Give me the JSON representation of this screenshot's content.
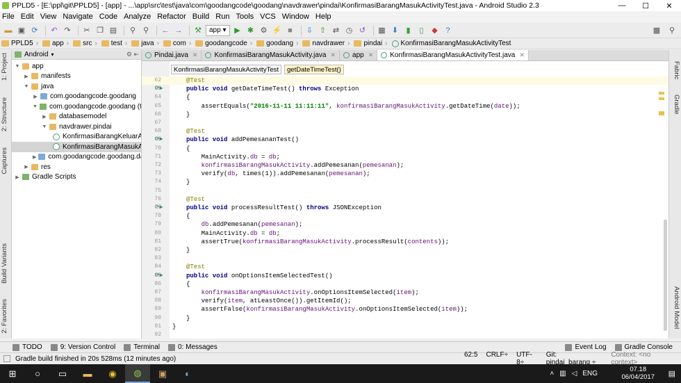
{
  "window": {
    "title": "PPLD5 - [E:\\ppl\\git\\PPLD5] - [app] - ...\\app\\src\\test\\java\\com\\goodangcode\\goodang\\navdrawer\\pindai\\KonfirmasiBarangMasukActivityTest.java - Android Studio 2.3"
  },
  "menu": [
    "File",
    "Edit",
    "View",
    "Navigate",
    "Code",
    "Analyze",
    "Refactor",
    "Build",
    "Run",
    "Tools",
    "VCS",
    "Window",
    "Help"
  ],
  "toolbar": {
    "run_config": "app"
  },
  "breadcrumb": [
    "PPLD5",
    "app",
    "src",
    "test",
    "java",
    "com",
    "goodangcode",
    "goodang",
    "navdrawer",
    "pindai",
    "KonfirmasiBarangMasukActivityTest"
  ],
  "left_tabs": [
    "1: Project",
    "2: Structure",
    "Captures",
    "Build Variants",
    "2: Favorites"
  ],
  "right_tabs": [
    "Fabric",
    "Gradle",
    "Android Model"
  ],
  "project": {
    "view": "Android",
    "tree": [
      {
        "label": "app",
        "level": 0,
        "icon": "folder",
        "open": true
      },
      {
        "label": "manifests",
        "level": 1,
        "icon": "folder",
        "open": false
      },
      {
        "label": "java",
        "level": 1,
        "icon": "folder",
        "open": true
      },
      {
        "label": "com.goodangcode.goodang",
        "level": 2,
        "icon": "package",
        "open": false
      },
      {
        "label": "com.goodangcode.goodang (test)",
        "level": 2,
        "icon": "package-test",
        "open": true
      },
      {
        "label": "databasemodel",
        "level": 3,
        "icon": "folder",
        "open": false
      },
      {
        "label": "navdrawer.pindai",
        "level": 3,
        "icon": "folder",
        "open": true
      },
      {
        "label": "KonfirmasiBarangKeluarActivityTest",
        "level": 4,
        "icon": "class"
      },
      {
        "label": "KonfirmasiBarangMasukActivityTest",
        "level": 4,
        "icon": "class",
        "selected": true
      },
      {
        "label": "com.goodangcode.goodang.database",
        "level": 2,
        "icon": "package",
        "open": false
      },
      {
        "label": "res",
        "level": 1,
        "icon": "folder",
        "open": false
      },
      {
        "label": "Gradle Scripts",
        "level": 0,
        "icon": "gradle",
        "open": false
      }
    ]
  },
  "tabs": [
    {
      "label": "Pindai.java",
      "active": false
    },
    {
      "label": "KonfirmasiBarangMasukActivity.java",
      "active": false
    },
    {
      "label": "app",
      "active": false
    },
    {
      "label": "KonfirmasiBarangMasukActivityTest.java",
      "active": true
    }
  ],
  "editor_breadcrumb": [
    "KonfirmasiBarangMasukActivityTest",
    "getDateTimeTest()"
  ],
  "code": [
    {
      "n": "62",
      "t": [
        [
          "ann",
          "@Test"
        ]
      ],
      "hl": true
    },
    {
      "n": "63",
      "gi": true,
      "t": [
        [
          "kw",
          "public void "
        ],
        [
          "",
          "getDateTimeTest() "
        ],
        [
          "kw",
          "throws "
        ],
        [
          "",
          "Exception"
        ]
      ]
    },
    {
      "n": "64",
      "t": [
        [
          "",
          "{"
        ]
      ]
    },
    {
      "n": "65",
      "t": [
        [
          "",
          "    assertEquals("
        ],
        [
          "str",
          "\"2016-11-11 11:11:11\""
        ],
        [
          "",
          ", "
        ],
        [
          "fld",
          "konfirmasiBarangMasukActivity"
        ],
        [
          "",
          ".getDateTime("
        ],
        [
          "fld",
          "date"
        ],
        [
          "",
          "));"
        ]
      ]
    },
    {
      "n": "66",
      "t": [
        [
          "",
          "}"
        ]
      ]
    },
    {
      "n": "67",
      "t": []
    },
    {
      "n": "68",
      "t": [
        [
          "ann",
          "@Test"
        ]
      ]
    },
    {
      "n": "69",
      "gi": true,
      "t": [
        [
          "kw",
          "public void "
        ],
        [
          "",
          "addPemesananTest()"
        ]
      ]
    },
    {
      "n": "70",
      "t": [
        [
          "",
          "{"
        ]
      ]
    },
    {
      "n": "71",
      "t": [
        [
          "",
          "    MainActivity."
        ],
        [
          "fld",
          "db"
        ],
        [
          "",
          " = "
        ],
        [
          "fld",
          "db"
        ],
        [
          "",
          ";"
        ]
      ]
    },
    {
      "n": "72",
      "t": [
        [
          "",
          "    "
        ],
        [
          "fld",
          "konfirmasiBarangMasukActivity"
        ],
        [
          "",
          ".addPemesanan("
        ],
        [
          "fld",
          "pemesanan"
        ],
        [
          "",
          ");"
        ]
      ]
    },
    {
      "n": "73",
      "t": [
        [
          "",
          "    verify("
        ],
        [
          "fld",
          "db"
        ],
        [
          "",
          ", times(1)).addPemesanan("
        ],
        [
          "fld",
          "pemesanan"
        ],
        [
          "",
          ");"
        ]
      ]
    },
    {
      "n": "74",
      "t": [
        [
          "",
          "}"
        ]
      ]
    },
    {
      "n": "75",
      "t": []
    },
    {
      "n": "76",
      "t": [
        [
          "ann",
          "@Test"
        ]
      ]
    },
    {
      "n": "77",
      "gi": true,
      "t": [
        [
          "kw",
          "public void "
        ],
        [
          "",
          "processResultTest() "
        ],
        [
          "kw",
          "throws "
        ],
        [
          "",
          "JSONException"
        ]
      ]
    },
    {
      "n": "78",
      "t": [
        [
          "",
          "{"
        ]
      ]
    },
    {
      "n": "79",
      "t": [
        [
          "",
          "    "
        ],
        [
          "fld",
          "db"
        ],
        [
          "",
          ".addPemesanan("
        ],
        [
          "fld",
          "pemesanan"
        ],
        [
          "",
          ");"
        ]
      ]
    },
    {
      "n": "80",
      "t": [
        [
          "",
          "    MainActivity."
        ],
        [
          "fld",
          "db"
        ],
        [
          "",
          " = "
        ],
        [
          "fld",
          "db"
        ],
        [
          "",
          ";"
        ]
      ]
    },
    {
      "n": "81",
      "t": [
        [
          "",
          "    assertTrue("
        ],
        [
          "fld",
          "konfirmasiBarangMasukActivity"
        ],
        [
          "",
          ".processResult("
        ],
        [
          "fld",
          "contents"
        ],
        [
          "",
          "));"
        ]
      ]
    },
    {
      "n": "82",
      "t": [
        [
          "",
          "}"
        ]
      ]
    },
    {
      "n": "83",
      "t": []
    },
    {
      "n": "84",
      "t": [
        [
          "ann",
          "@Test"
        ]
      ]
    },
    {
      "n": "85",
      "gi": true,
      "t": [
        [
          "kw",
          "public void "
        ],
        [
          "",
          "onOptionsItemSelectedTest()"
        ]
      ]
    },
    {
      "n": "86",
      "t": [
        [
          "",
          "{"
        ]
      ]
    },
    {
      "n": "87",
      "t": [
        [
          "",
          "    "
        ],
        [
          "fld",
          "konfirmasiBarangMasukActivity"
        ],
        [
          "",
          ".onOptionsItemSelected("
        ],
        [
          "fld",
          "item"
        ],
        [
          "",
          ");"
        ]
      ]
    },
    {
      "n": "88",
      "t": [
        [
          "",
          "    verify("
        ],
        [
          "fld",
          "item"
        ],
        [
          "",
          ", atLeastOnce()).getItemId();"
        ]
      ]
    },
    {
      "n": "89",
      "t": [
        [
          "",
          "    assertFalse("
        ],
        [
          "fld",
          "konfirmasiBarangMasukActivity"
        ],
        [
          "",
          ".onOptionsItemSelected("
        ],
        [
          "fld",
          "item"
        ],
        [
          "",
          "));"
        ]
      ]
    },
    {
      "n": "90",
      "t": [
        [
          "",
          "}"
        ]
      ]
    },
    {
      "n": "91",
      "t": [
        [
          "",
          "}"
        ]
      ],
      "outer": true
    },
    {
      "n": "92",
      "t": []
    }
  ],
  "bottom_tabs": [
    "TODO",
    "9: Version Control",
    "Terminal",
    "0: Messages",
    "Event Log",
    "Gradle Console"
  ],
  "status": {
    "message": "Gradle build finished in 20s 528ms (12 minutes ago)",
    "position": "62:5",
    "line_sep": "CRLF÷",
    "encoding": "UTF-8÷",
    "git": "Git: pindai_barang ÷",
    "context": "Context: <no context>"
  },
  "taskbar": {
    "lang": "ENG",
    "time": "07.18",
    "date": "06/04/2017"
  }
}
